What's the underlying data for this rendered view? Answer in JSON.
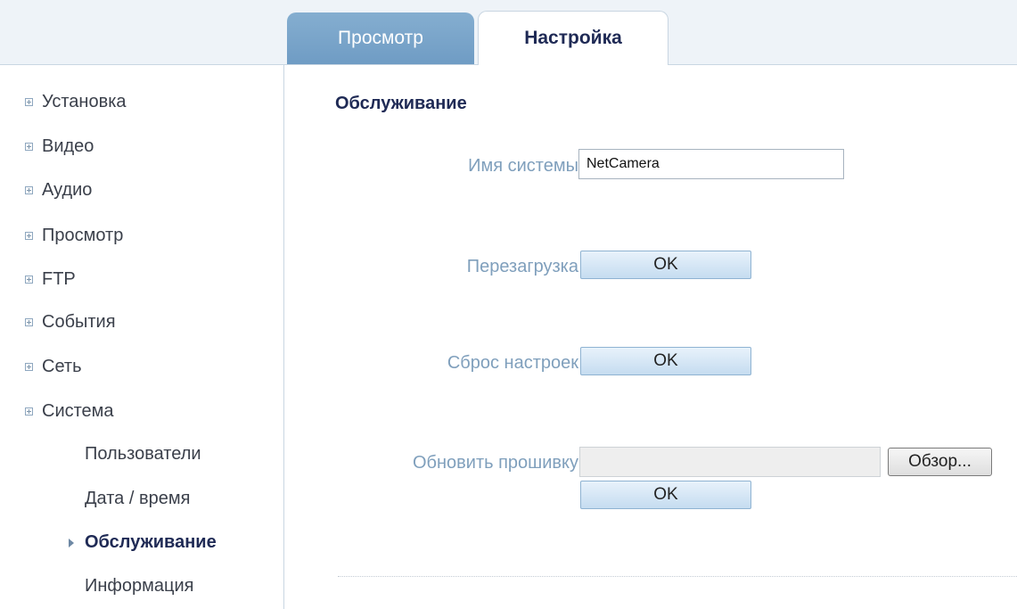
{
  "tabs": {
    "view": "Просмотр",
    "settings": "Настройка"
  },
  "sidebar": {
    "items": [
      {
        "label": "Установка"
      },
      {
        "label": "Видео"
      },
      {
        "label": "Аудио"
      },
      {
        "label": "Просмотр"
      },
      {
        "label": "FTP"
      },
      {
        "label": "События"
      },
      {
        "label": "Сеть"
      },
      {
        "label": "Система"
      }
    ],
    "sub_items": [
      {
        "label": "Пользователи"
      },
      {
        "label": "Дата / время"
      },
      {
        "label": "Обслуживание",
        "active": true
      },
      {
        "label": "Информация"
      }
    ]
  },
  "main": {
    "title": "Обслуживание",
    "system_name_label": "Имя системы",
    "system_name_value": "NetCamera",
    "reboot_label": "Перезагрузка",
    "reboot_button": "OK",
    "reset_label": "Сброс настроек",
    "reset_button": "OK",
    "firmware_label": "Обновить прошивку",
    "browse_button": "Обзор...",
    "firmware_button": "OK"
  },
  "colors": {
    "tab_active_text": "#1f2a55",
    "tab_inactive_bg": "#7aa3c8",
    "label_text": "#7f9fbc",
    "button_bg": "#d4e6f6"
  }
}
